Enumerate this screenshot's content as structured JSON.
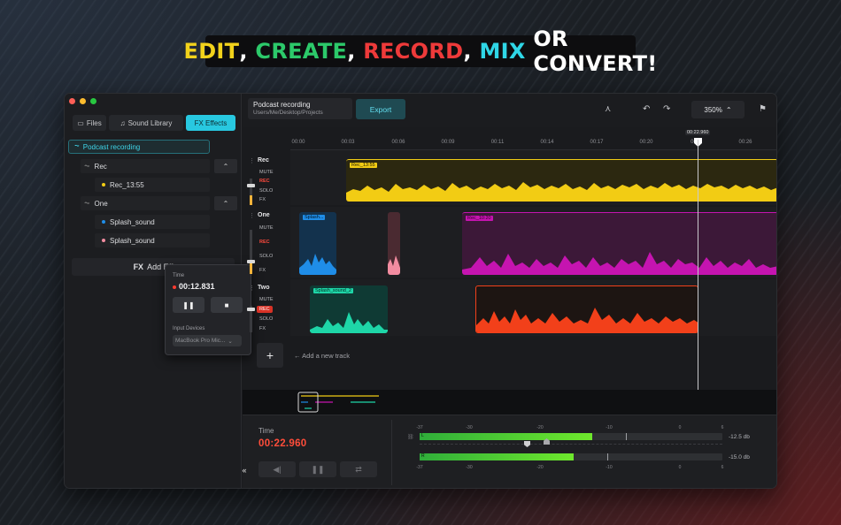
{
  "headline": {
    "edit": "EDIT",
    "comma1": ",",
    "create": "CREATE",
    "comma2": ",",
    "record": "RECORD",
    "comma3": ",",
    "mix": "MIX",
    "rest": "OR CONVERT!"
  },
  "colors": {
    "accent": "#28c8e0",
    "yellow": "#f2cc14",
    "magenta": "#c514b0",
    "blue": "#1f8de8",
    "pink": "#f28ca0",
    "teal": "#1ed6a8",
    "red_orange": "#f2401a"
  },
  "sidebar": {
    "tabs": [
      {
        "label": "Files",
        "icon": "folder-icon"
      },
      {
        "label": "Sound Library",
        "icon": "music-library-icon"
      },
      {
        "label": "FX Effects",
        "icon": "fx-icon",
        "active": true
      }
    ],
    "project": "Podcast recording",
    "groups": [
      {
        "name": "Rec",
        "items": [
          {
            "name": "Rec_13:55",
            "color": "#f2cc14"
          }
        ]
      },
      {
        "name": "One",
        "items": [
          {
            "name": "Splash_sound",
            "color": "#1f8de8"
          },
          {
            "name": "Splash_sound",
            "color": "#f28ca0"
          }
        ]
      }
    ],
    "add_effect": "Add Eff",
    "add_effect_icon": "FX"
  },
  "recorder_popup": {
    "time_label": "Time",
    "time": "00:12.831",
    "pause": "❚❚",
    "stop": "■",
    "input_label": "Input Devices",
    "input_value": "MacBook Pro Mic..."
  },
  "toolbar": {
    "file_title": "Podcast recording",
    "file_path": "Users/Me/Desktop/Projects",
    "export": "Export",
    "zoom": "350%"
  },
  "ruler": {
    "ticks": [
      "00:00",
      "00:03",
      "00:06",
      "00:09",
      "00:11",
      "00:14",
      "00:17",
      "00:20",
      "00:2",
      "00:26"
    ],
    "playhead": "00:22.960"
  },
  "tracks": [
    {
      "name": "Rec",
      "buttons": [
        "MUTE",
        "REC",
        "SOLO",
        "FX"
      ],
      "fader": 0.35,
      "clips": [
        {
          "label": "Rec_13:55",
          "color": "#f2cc14"
        }
      ]
    },
    {
      "name": "One",
      "buttons": [
        "MUTE",
        "REC",
        "SOLO",
        "FX"
      ],
      "fader": 0.3,
      "clips": [
        {
          "label": "Splash...",
          "color": "#1f8de8"
        },
        {
          "label": "",
          "color": "#f28ca0"
        },
        {
          "label": "Rec_10:20",
          "color": "#c514b0"
        }
      ]
    },
    {
      "name": "Two",
      "buttons": [
        "MUTE",
        "REC",
        "SOLO",
        "FX"
      ],
      "fader": 0.0,
      "clips": [
        {
          "label": "Splash_sound_2",
          "color": "#1ed6a8"
        },
        {
          "label": "",
          "color": "#f2401a"
        }
      ]
    }
  ],
  "add_track": {
    "button": "+",
    "hint": "← Add a new track"
  },
  "transport": {
    "time_label": "Time",
    "time": "00:22.960",
    "buttons": [
      "◀|",
      "❚❚",
      "⇄"
    ],
    "collapse": "«"
  },
  "meters": {
    "scale": [
      "-37",
      "-30",
      "-20",
      "-10",
      "0",
      "6"
    ],
    "channels": [
      {
        "name": "L",
        "level": 0.57,
        "peak": 0.68,
        "db": "-12.5 db"
      },
      {
        "name": "R",
        "level": 0.51,
        "peak": 0.62,
        "db": "-15.0 db"
      }
    ]
  }
}
